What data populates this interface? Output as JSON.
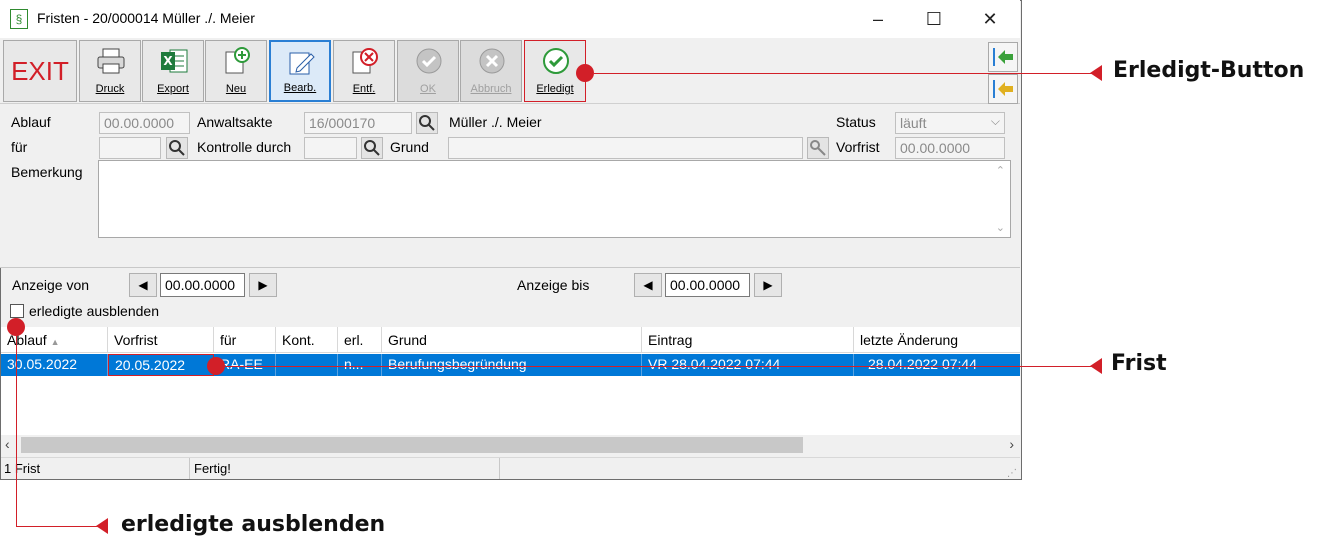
{
  "window": {
    "icon_glyph": "§",
    "title": "Fristen - 20/000014 Müller ./. Meier",
    "controls": [
      "–",
      "☐",
      "✕"
    ]
  },
  "toolbar": {
    "exit_label": "EXIT",
    "buttons": [
      {
        "label": "Druck",
        "icon": "printer-icon"
      },
      {
        "label": "Export",
        "icon": "excel-icon"
      },
      {
        "label": "Neu",
        "icon": "new-icon"
      },
      {
        "label": "Bearb.",
        "icon": "edit-icon"
      },
      {
        "label": "Entf.",
        "icon": "delete-icon"
      },
      {
        "label": "OK",
        "icon": "ok-icon",
        "disabled": true
      },
      {
        "label": "Abbruch",
        "icon": "cancel-icon",
        "disabled": true
      },
      {
        "label": "Erledigt",
        "icon": "done-icon"
      }
    ],
    "accent_color": "#d21f28",
    "excel_color": "#1e7b3c"
  },
  "form": {
    "ablauf_label": "Ablauf",
    "ablauf_value": "00.00.0000",
    "anwaltsakte_label": "Anwaltsakte",
    "anwaltsakte_value": "16/000170",
    "parties": "Müller ./. Meier",
    "status_label": "Status",
    "status_value": "läuft",
    "fuer_label": "für",
    "fuer_value": "",
    "kontrolle_label": "Kontrolle durch",
    "kontrolle_value": "",
    "grund_label": "Grund",
    "grund_value": "",
    "vorfrist_label": "Vorfrist",
    "vorfrist_value": "00.00.0000",
    "bemerkung_label": "Bemerkung"
  },
  "filter": {
    "anzeige_von_label": "Anzeige von",
    "anzeige_von_value": "00.00.0000",
    "anzeige_bis_label": "Anzeige bis",
    "anzeige_bis_value": "00.00.0000",
    "hide_done_label": "erledigte ausblenden",
    "hide_done_checked": false
  },
  "grid": {
    "columns": [
      "Ablauf",
      "Vorfrist",
      "für",
      "Kont.",
      "erl.",
      "Grund",
      "Eintrag",
      "letzte Änderung"
    ],
    "rows": [
      [
        "30.05.2022",
        "20.05.2022",
        "RA-EE",
        "",
        "n...",
        "Berufungsbegründung",
        "VR 28.04.2022  07:44",
        "28.04.2022  07:44"
      ]
    ],
    "selected_color": "#0078d7"
  },
  "status_bar": {
    "count": "1 Frist",
    "message": "Fertig!"
  },
  "annotations": {
    "erledigt_button": "Erledigt-Button",
    "frist": "Frist",
    "erledigte_ausblenden": "erledigte ausblenden",
    "color": "#d21f28"
  }
}
